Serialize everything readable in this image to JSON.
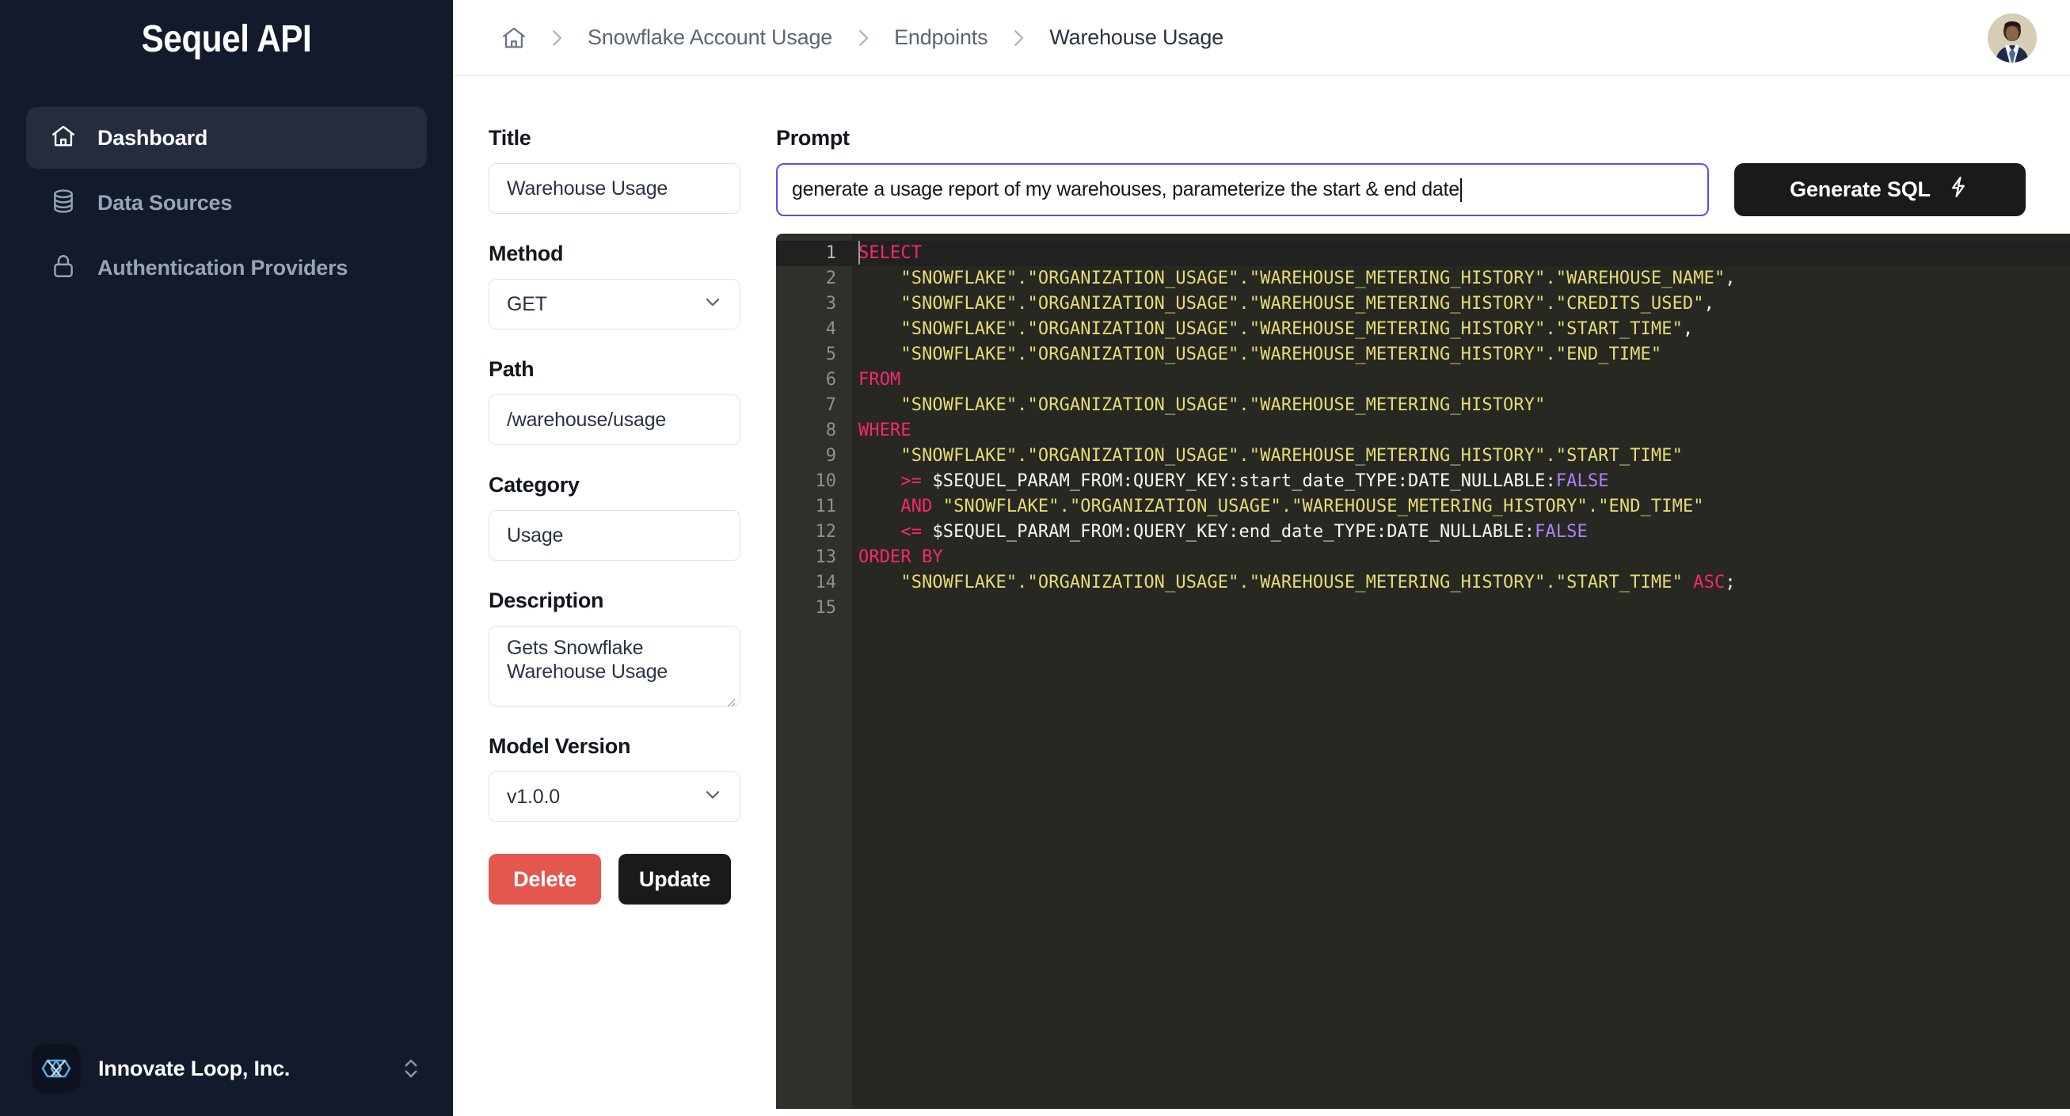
{
  "app": {
    "brand": "Sequel API"
  },
  "sidebar": {
    "items": [
      {
        "label": "Dashboard",
        "icon": "home-icon",
        "active": true
      },
      {
        "label": "Data Sources",
        "icon": "database-icon",
        "active": false
      },
      {
        "label": "Authentication Providers",
        "icon": "lock-icon",
        "active": false
      }
    ],
    "org": {
      "name": "Innovate Loop, Inc.",
      "logo_icon": "infinity-hexagon-logo",
      "switch_icon": "chevron-up-down-icon"
    }
  },
  "topbar": {
    "breadcrumb": {
      "home_icon": "home-icon",
      "separator_icon": "chevron-right-icon",
      "items": [
        "Snowflake Account Usage",
        "Endpoints",
        "Warehouse Usage"
      ]
    },
    "avatar": "user-avatar"
  },
  "form": {
    "title": {
      "label": "Title",
      "value": "Warehouse Usage"
    },
    "method": {
      "label": "Method",
      "value": "GET",
      "chevron_icon": "chevron-down-icon"
    },
    "path": {
      "label": "Path",
      "value": "/warehouse/usage"
    },
    "category": {
      "label": "Category",
      "value": "Usage"
    },
    "description": {
      "label": "Description",
      "value": "Gets Snowflake Warehouse Usage"
    },
    "model_version": {
      "label": "Model Version",
      "value": "v1.0.0",
      "chevron_icon": "chevron-down-icon"
    },
    "delete_label": "Delete",
    "update_label": "Update"
  },
  "prompt": {
    "label": "Prompt",
    "value": "generate a usage report of my warehouses, parameterize the start & end date",
    "generate_label": "Generate SQL",
    "generate_icon": "lightning-bolt-icon"
  },
  "editor": {
    "line_numbers": [
      "1",
      "2",
      "3",
      "4",
      "5",
      "6",
      "7",
      "8",
      "9",
      "10",
      "11",
      "12",
      "13",
      "14",
      "15"
    ],
    "active_line": 1,
    "lines": [
      [
        {
          "t": "SELECT",
          "c": "k"
        }
      ],
      [
        {
          "t": "    ",
          "c": "p"
        },
        {
          "t": "\"SNOWFLAKE\".\"ORGANIZATION_USAGE\".\"WAREHOUSE_METERING_HISTORY\".\"WAREHOUSE_NAME\"",
          "c": "s"
        },
        {
          "t": ",",
          "c": "p"
        }
      ],
      [
        {
          "t": "    ",
          "c": "p"
        },
        {
          "t": "\"SNOWFLAKE\".\"ORGANIZATION_USAGE\".\"WAREHOUSE_METERING_HISTORY\".\"CREDITS_USED\"",
          "c": "s"
        },
        {
          "t": ",",
          "c": "p"
        }
      ],
      [
        {
          "t": "    ",
          "c": "p"
        },
        {
          "t": "\"SNOWFLAKE\".\"ORGANIZATION_USAGE\".\"WAREHOUSE_METERING_HISTORY\".\"START_TIME\"",
          "c": "s"
        },
        {
          "t": ",",
          "c": "p"
        }
      ],
      [
        {
          "t": "    ",
          "c": "p"
        },
        {
          "t": "\"SNOWFLAKE\".\"ORGANIZATION_USAGE\".\"WAREHOUSE_METERING_HISTORY\".\"END_TIME\"",
          "c": "s"
        }
      ],
      [
        {
          "t": "FROM",
          "c": "k"
        }
      ],
      [
        {
          "t": "    ",
          "c": "p"
        },
        {
          "t": "\"SNOWFLAKE\".\"ORGANIZATION_USAGE\".\"WAREHOUSE_METERING_HISTORY\"",
          "c": "s"
        }
      ],
      [
        {
          "t": "WHERE",
          "c": "k"
        }
      ],
      [
        {
          "t": "    ",
          "c": "p"
        },
        {
          "t": "\"SNOWFLAKE\".\"ORGANIZATION_USAGE\".\"WAREHOUSE_METERING_HISTORY\".\"START_TIME\"",
          "c": "s"
        }
      ],
      [
        {
          "t": "    ",
          "c": "p"
        },
        {
          "t": ">=",
          "c": "op"
        },
        {
          "t": " $SEQUEL_PARAM_FROM:QUERY_KEY:start_date_TYPE:DATE_NULLABLE:",
          "c": "p"
        },
        {
          "t": "FALSE",
          "c": "b"
        }
      ],
      [
        {
          "t": "    ",
          "c": "p"
        },
        {
          "t": "AND",
          "c": "k"
        },
        {
          "t": " ",
          "c": "p"
        },
        {
          "t": "\"SNOWFLAKE\".\"ORGANIZATION_USAGE\".\"WAREHOUSE_METERING_HISTORY\".\"END_TIME\"",
          "c": "s"
        }
      ],
      [
        {
          "t": "    ",
          "c": "p"
        },
        {
          "t": "<=",
          "c": "op"
        },
        {
          "t": " $SEQUEL_PARAM_FROM:QUERY_KEY:end_date_TYPE:DATE_NULLABLE:",
          "c": "p"
        },
        {
          "t": "FALSE",
          "c": "b"
        }
      ],
      [
        {
          "t": "ORDER BY",
          "c": "k"
        }
      ],
      [
        {
          "t": "    ",
          "c": "p"
        },
        {
          "t": "\"SNOWFLAKE\".\"ORGANIZATION_USAGE\".\"WAREHOUSE_METERING_HISTORY\".\"START_TIME\"",
          "c": "s"
        },
        {
          "t": " ",
          "c": "p"
        },
        {
          "t": "ASC",
          "c": "k"
        },
        {
          "t": ";",
          "c": "p"
        }
      ],
      []
    ]
  },
  "colors": {
    "sidebar_bg": "#121a2b",
    "accent_focus": "#5b4df0",
    "delete_red": "#e4574f",
    "dark_button": "#1a1a1a",
    "editor_bg": "#272822",
    "keyword_pink": "#f92672",
    "string_yellow": "#e6db74",
    "boolean_purple": "#ae81ff"
  }
}
